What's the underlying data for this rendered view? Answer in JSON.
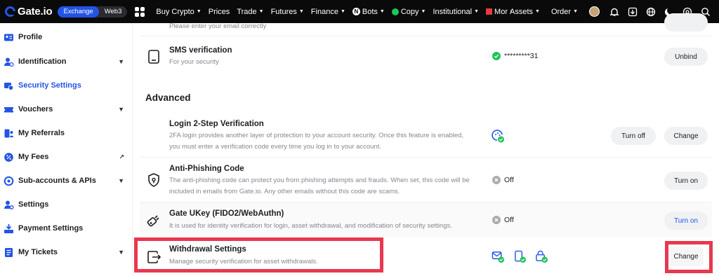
{
  "topbar": {
    "logo": "Gate.io",
    "switch": [
      "Exchange",
      "Web3"
    ],
    "nav": [
      {
        "label": "Buy Crypto",
        "caret": true
      },
      {
        "label": "Prices",
        "caret": false
      },
      {
        "label": "Trade",
        "caret": true
      },
      {
        "label": "Futures",
        "caret": true
      },
      {
        "label": "Finance",
        "caret": true
      },
      {
        "label": "Bots",
        "caret": true
      },
      {
        "label": "Copy",
        "caret": true
      },
      {
        "label": "Institutional",
        "caret": true
      },
      {
        "label": "Mor",
        "caret": false
      }
    ],
    "right": [
      "Assets",
      "Order"
    ],
    "icons": [
      "bell-icon",
      "download-icon",
      "globe-icon",
      "moon-icon",
      "settings-icon",
      "search-icon"
    ]
  },
  "sidebar": {
    "items": [
      {
        "label": "Profile",
        "icon": "profile-card-icon",
        "expandable": false,
        "external": false,
        "active": false
      },
      {
        "label": "Identification",
        "icon": "person-check-icon",
        "expandable": true,
        "external": false,
        "active": false
      },
      {
        "label": "Security Settings",
        "icon": "shield-icon",
        "expandable": false,
        "external": false,
        "active": true
      },
      {
        "label": "Vouchers",
        "icon": "ticket-icon",
        "expandable": true,
        "external": false,
        "active": false
      },
      {
        "label": "My Referrals",
        "icon": "referral-icon",
        "expandable": false,
        "external": false,
        "active": false
      },
      {
        "label": "My Fees",
        "icon": "percent-icon",
        "expandable": false,
        "external": true,
        "active": false
      },
      {
        "label": "Sub-accounts & APIs",
        "icon": "sub-accounts-icon",
        "expandable": true,
        "external": false,
        "active": false
      },
      {
        "label": "Settings",
        "icon": "person-gear-icon",
        "expandable": false,
        "external": false,
        "active": false
      },
      {
        "label": "Payment Settings",
        "icon": "payment-icon",
        "expandable": false,
        "external": false,
        "active": false
      },
      {
        "label": "My Tickets",
        "icon": "tickets-icon",
        "expandable": true,
        "external": false,
        "active": false
      }
    ]
  },
  "main": {
    "top_partial": {
      "desc": "Please enter your email correctly"
    },
    "sms": {
      "title": "SMS verification",
      "desc": "For your security",
      "status": "*********31",
      "button": "Unbind"
    },
    "advanced_title": "Advanced",
    "twofa": {
      "title": "Login 2-Step Verification",
      "desc": "2FA login provides another layer of protection to your account security. Once this feature is enabled, you must enter a verification code every time you log in to your account.",
      "buttons": [
        "Turn off",
        "Change"
      ]
    },
    "antiphishing": {
      "title": "Anti-Phishing Code",
      "desc": "The anti-phishing code can protect you from phishing attempts and frauds. When set, this code will be included in emails from Gate.io. Any other emails without this code are scams.",
      "status": "Off",
      "button": "Turn on"
    },
    "ukey": {
      "title": "Gate UKey (FIDO2/WebAuthn)",
      "desc": "It is used for identity verification for login, asset withdrawal, and modification of security settings.",
      "status": "Off",
      "button": "Turn on"
    },
    "withdrawal": {
      "title": "Withdrawal Settings",
      "desc": "Manage security verification for asset withdrawals.",
      "button": "Change"
    }
  },
  "colors": {
    "accent": "#2354e6",
    "highlight": "#e8384f",
    "success": "#20c35b"
  }
}
